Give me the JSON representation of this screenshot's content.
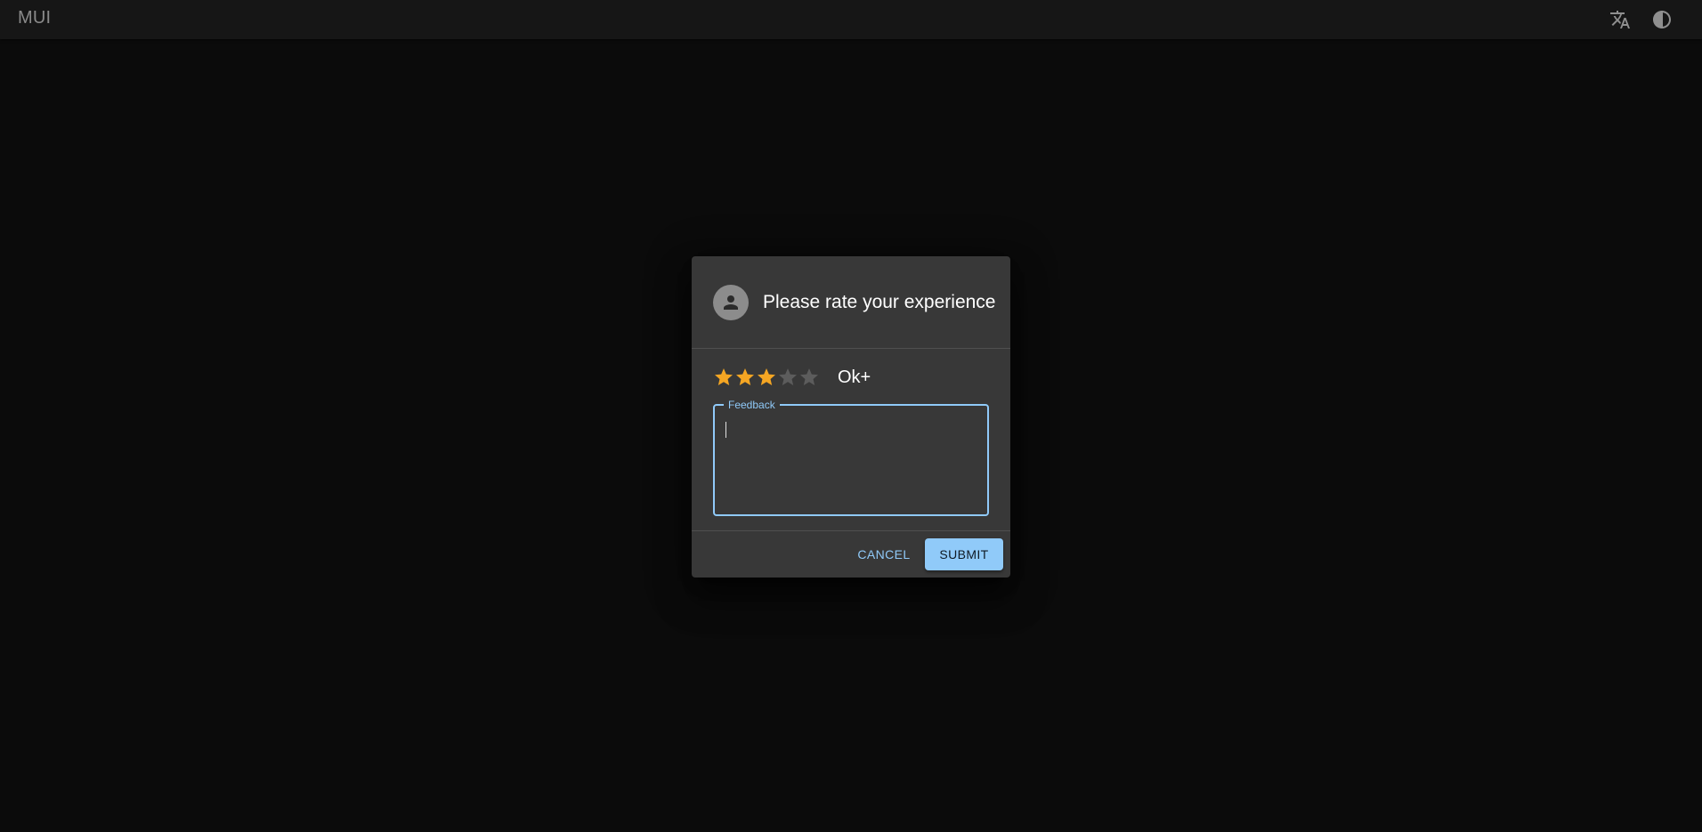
{
  "appbar": {
    "brand": "MUI",
    "icons": [
      "translate-icon",
      "contrast-icon"
    ]
  },
  "dialog": {
    "title": "Please rate your experience",
    "avatar_icon": "person-icon",
    "rating": {
      "value": 3,
      "max": 5,
      "label": "Ok+",
      "filled_color": "#f5a623",
      "empty_color": "#5c5c5c"
    },
    "feedback": {
      "label": "Feedback",
      "value": ""
    },
    "actions": {
      "cancel_label": "Cancel",
      "submit_label": "Submit"
    }
  },
  "colors": {
    "accent": "#90caf9",
    "background": "#0b0b0b",
    "surface": "#383838"
  }
}
